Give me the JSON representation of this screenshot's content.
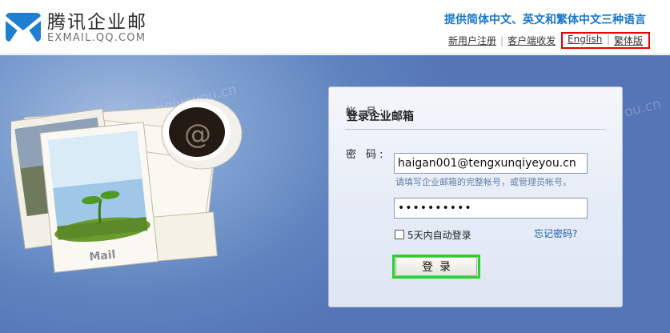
{
  "header": {
    "brand_name": "腾讯企业邮",
    "brand_domain": "EXMAIL.QQ.COM",
    "tagline": "提供简体中文、英文和繁体中文三种语言",
    "links": [
      {
        "label": "新用户注册"
      },
      {
        "label": "客户端收发"
      }
    ],
    "lang_english": "English",
    "lang_traditional": "繁体版",
    "separator": "|"
  },
  "watermark": "www.tengxunqiyeyou.cn",
  "illustration": {
    "photo_caption": "Mail"
  },
  "login": {
    "title": "登录企业邮箱",
    "account_label": "帐 号:",
    "account_value": "haigan001@tengxunqiyeyou.cn",
    "account_hint": "请填写企业邮箱的完整帐号，或管理员帐号。",
    "password_label": "密 码:",
    "password_value": "••••••••••",
    "remember_label": "5天内自动登录",
    "forgot_label": "忘记密码?",
    "submit_label": "登录"
  },
  "colors": {
    "tagline": "#1677c9",
    "background": "#5f83bf",
    "highlight_red": "#e20000",
    "highlight_green": "#2bd12b"
  }
}
